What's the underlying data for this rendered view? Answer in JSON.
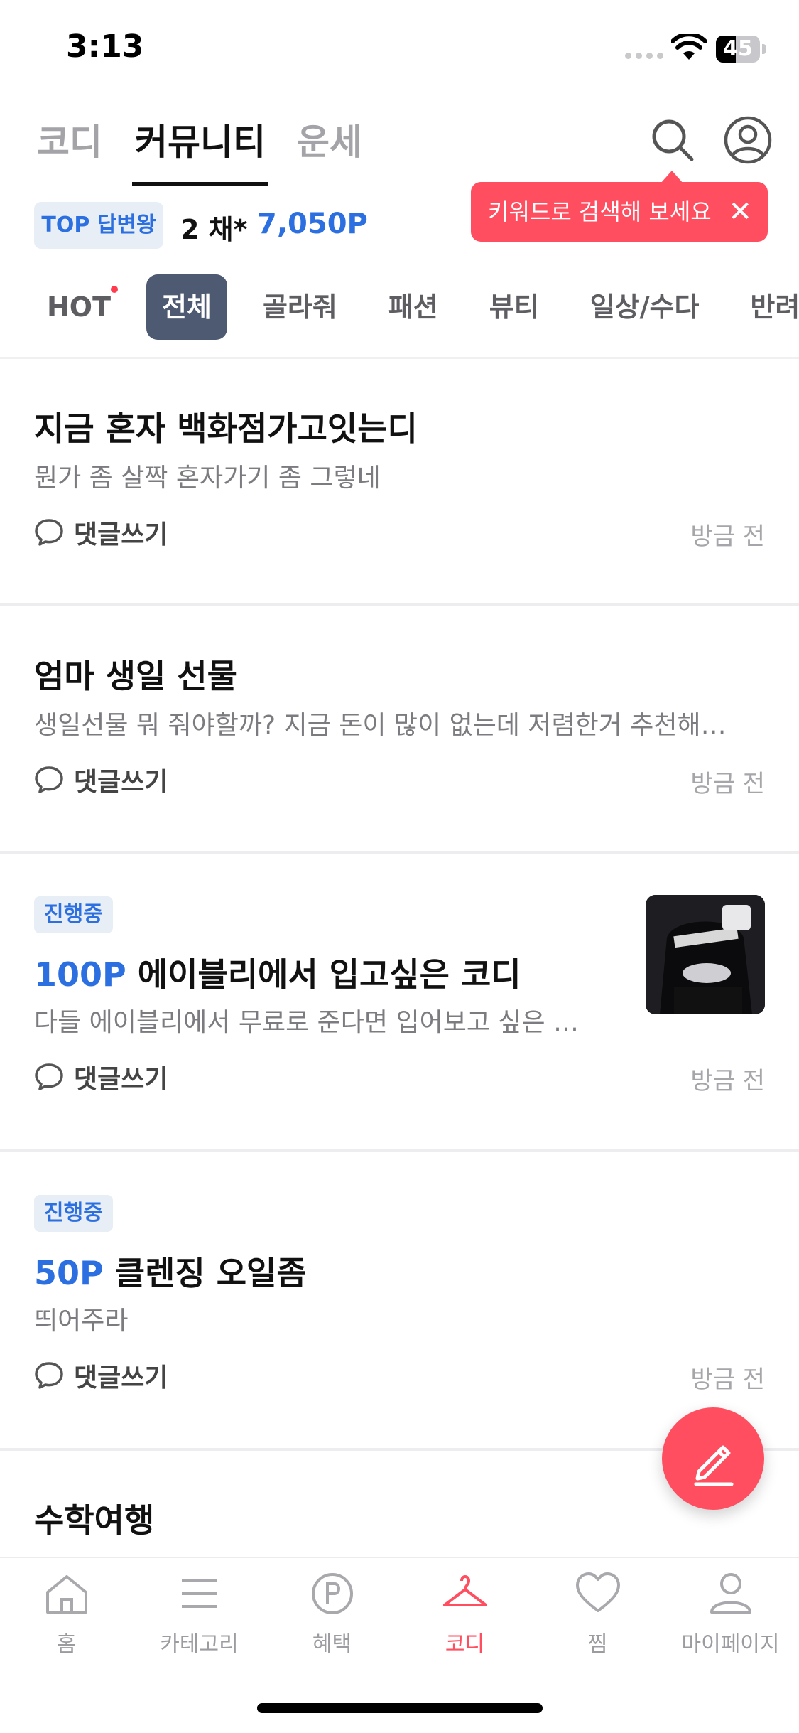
{
  "status_bar": {
    "time": "3:13",
    "battery": "45",
    "battery_level": 0.45
  },
  "top_tabs": [
    "코디",
    "커뮤니티",
    "운세"
  ],
  "active_tab": "커뮤니티",
  "points": {
    "badge": "TOP 답변왕",
    "count": "2 채*",
    "value": "7,050P"
  },
  "tooltip": {
    "text": "키워드로 검색해 보세요",
    "close": "✕"
  },
  "categories": [
    "HOT",
    "전체",
    "골라줘",
    "패션",
    "뷰티",
    "일상/수다",
    "반려동"
  ],
  "active_category": "전체",
  "posts": [
    {
      "title": "지금 혼자 백화점가고잇는디",
      "body": "뭔가 좀 살짝 혼자가기 좀 그렇네",
      "comment": "댓글쓰기",
      "time": "방금 전"
    },
    {
      "title": "엄마 생일 선물",
      "body": "생일선물 뭐 줘야할까? 지금 돈이 많이 없는데 저렴한거 추천해…",
      "comment": "댓글쓰기",
      "time": "방금 전"
    },
    {
      "badge": "진행중",
      "points": "100P",
      "title": "에이블리에서 입고싶은 코디",
      "body": "다들 에이블리에서 무료로 준다면 입어보고 싶은 …",
      "comment": "댓글쓰기",
      "time": "방금 전"
    },
    {
      "badge": "진행중",
      "points": "50P",
      "title": "클렌징 오일좀",
      "body": "띄어주라",
      "comment": "댓글쓰기",
      "time": "방금 전"
    },
    {
      "title": "수학여행"
    }
  ],
  "bottom_nav": [
    "홈",
    "카테고리",
    "혜택",
    "코디",
    "찜",
    "마이페이지"
  ],
  "colors": {
    "accent": "#ff4e5f",
    "blue": "#2b6fe0",
    "chip_active": "#4e5a71"
  },
  "icons": [
    "search-icon",
    "profile-icon",
    "comment-icon",
    "pencil-icon",
    "home-icon",
    "menu-icon",
    "points-icon",
    "hanger-icon",
    "heart-icon",
    "user-icon"
  ]
}
